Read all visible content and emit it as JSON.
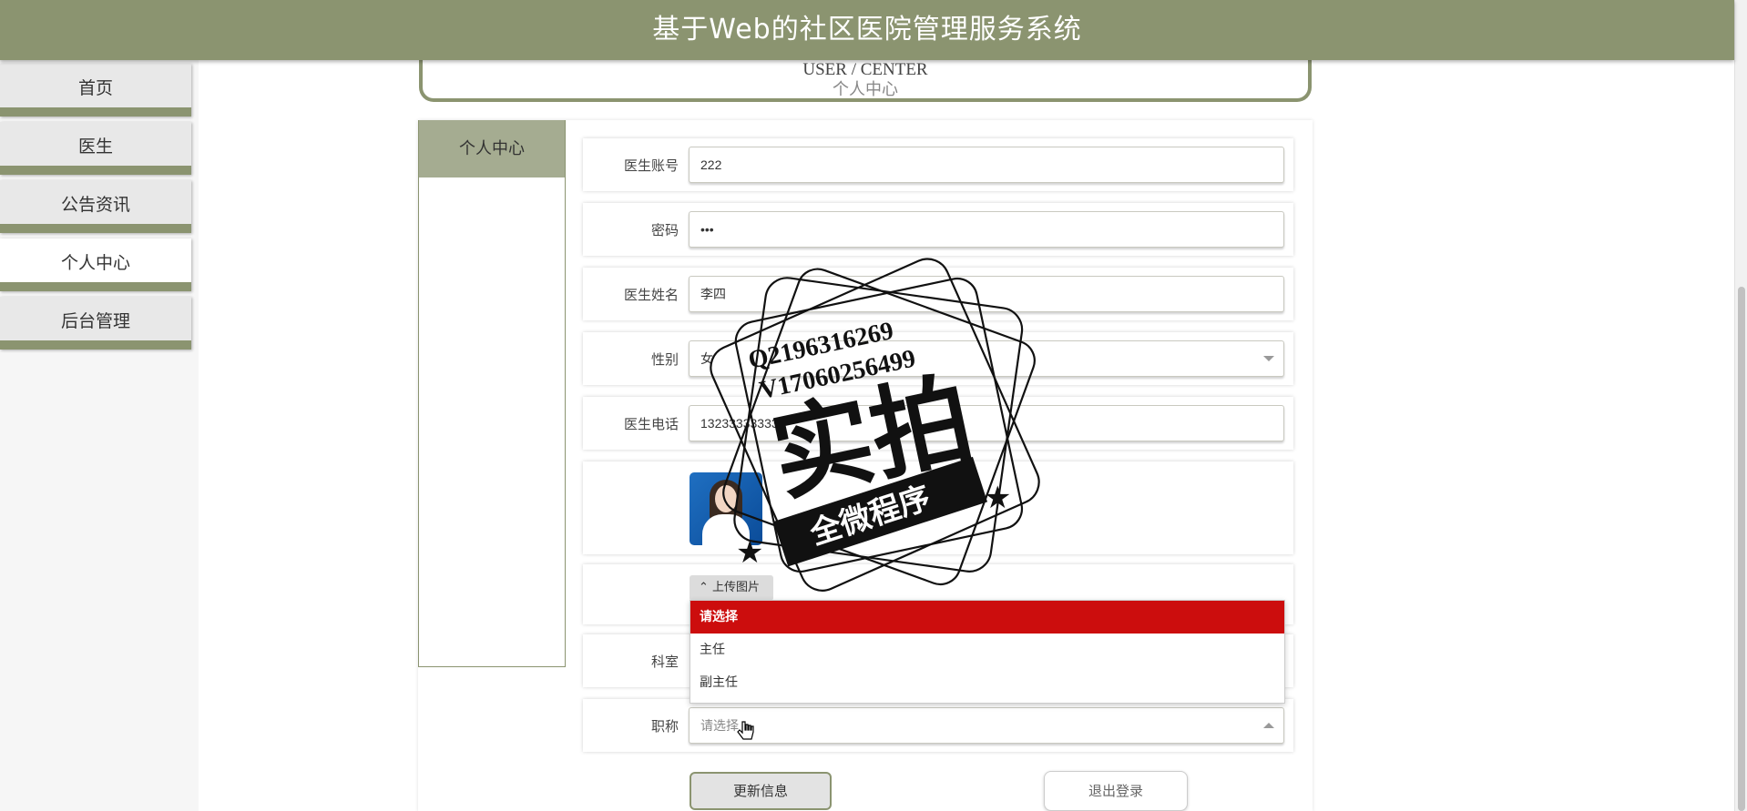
{
  "header": {
    "title": "基于Web的社区医院管理服务系统"
  },
  "sidebar": {
    "items": [
      {
        "label": "首页"
      },
      {
        "label": "医生"
      },
      {
        "label": "公告资讯"
      },
      {
        "label": "个人中心"
      },
      {
        "label": "后台管理"
      }
    ],
    "active_index": 3
  },
  "page_title": {
    "en": "USER / CENTER",
    "cn": "个人中心"
  },
  "side_menu": {
    "item": "个人中心"
  },
  "form": {
    "account": {
      "label": "医生账号",
      "value": "222"
    },
    "password": {
      "label": "密码",
      "value": "•••"
    },
    "name": {
      "label": "医生姓名",
      "value": "李四"
    },
    "gender": {
      "label": "性别",
      "value": "女"
    },
    "phone": {
      "label": "医生电话",
      "value": "13233333333"
    },
    "upload": {
      "label": "上传图片"
    },
    "department": {
      "label": "科室"
    },
    "title": {
      "label": "职称",
      "placeholder": "请选择"
    }
  },
  "dropdown": {
    "options": [
      "请选择",
      "主任",
      "副主任"
    ],
    "selected_index": 0
  },
  "buttons": {
    "update": "更新信息",
    "logout": "退出登录"
  },
  "watermark": {
    "line1": "Q2196316269",
    "line2": "V17060256499",
    "main": "实拍",
    "banner": "全微程序"
  },
  "colors": {
    "accent": "#8b9470",
    "selected_option": "#cc0d0d"
  }
}
